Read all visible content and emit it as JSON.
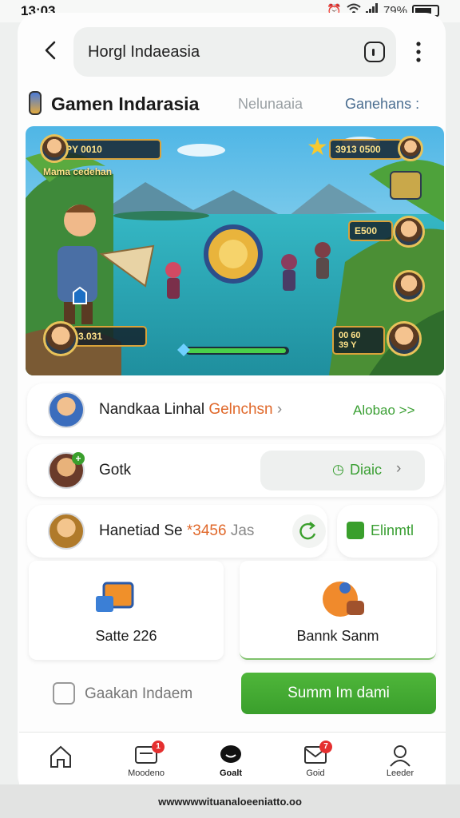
{
  "status_bar": {
    "time": "13:03",
    "battery": "79%"
  },
  "header": {
    "search_value": "Horgl Indaeasia"
  },
  "section": {
    "title": "Gamen Indarasia",
    "tab_1": "Nelunaaia",
    "tab_2": "Ganehans :"
  },
  "banner": {
    "hud_top_left": "PY 0010",
    "hud_subtitle": "Mama cedehan",
    "hud_top_right": "3913 0500",
    "hud_right_mid": "E500",
    "hud_bottom_left": "3.031",
    "hud_bottom_right": "00 60\n39 Y"
  },
  "rows": {
    "row1": {
      "name": "Nandkaa Linhal",
      "highlight": "Gelnchsn",
      "link": "Alobao >>"
    },
    "row2": {
      "name": "Gotk",
      "action": "Diaic"
    },
    "row3": {
      "name": "Hanetiad Se",
      "accent": "*3456",
      "suffix": "Jas",
      "action": "Elinmtl"
    }
  },
  "tiles": {
    "left": "Satte 226",
    "right": "Bannk Sanm"
  },
  "bottom": {
    "left_label": "Gaakan Indaem",
    "cta": "Summ Im dami"
  },
  "nav": {
    "items": [
      {
        "label": "",
        "icon": "home-icon"
      },
      {
        "label": "Moodeno",
        "icon": "inbox-icon",
        "badge": "1"
      },
      {
        "label": "Goalt",
        "icon": "chat-icon"
      },
      {
        "label": "Goid",
        "icon": "mail-icon",
        "badge": "7"
      },
      {
        "label": "Leeder",
        "icon": "profile-icon"
      }
    ]
  },
  "footer": {
    "url": "wwwwwwituanaloeeniatto.oo"
  },
  "colors": {
    "accent_green": "#3a9f2c",
    "accent_orange": "#e0682a",
    "badge_red": "#e53030"
  }
}
